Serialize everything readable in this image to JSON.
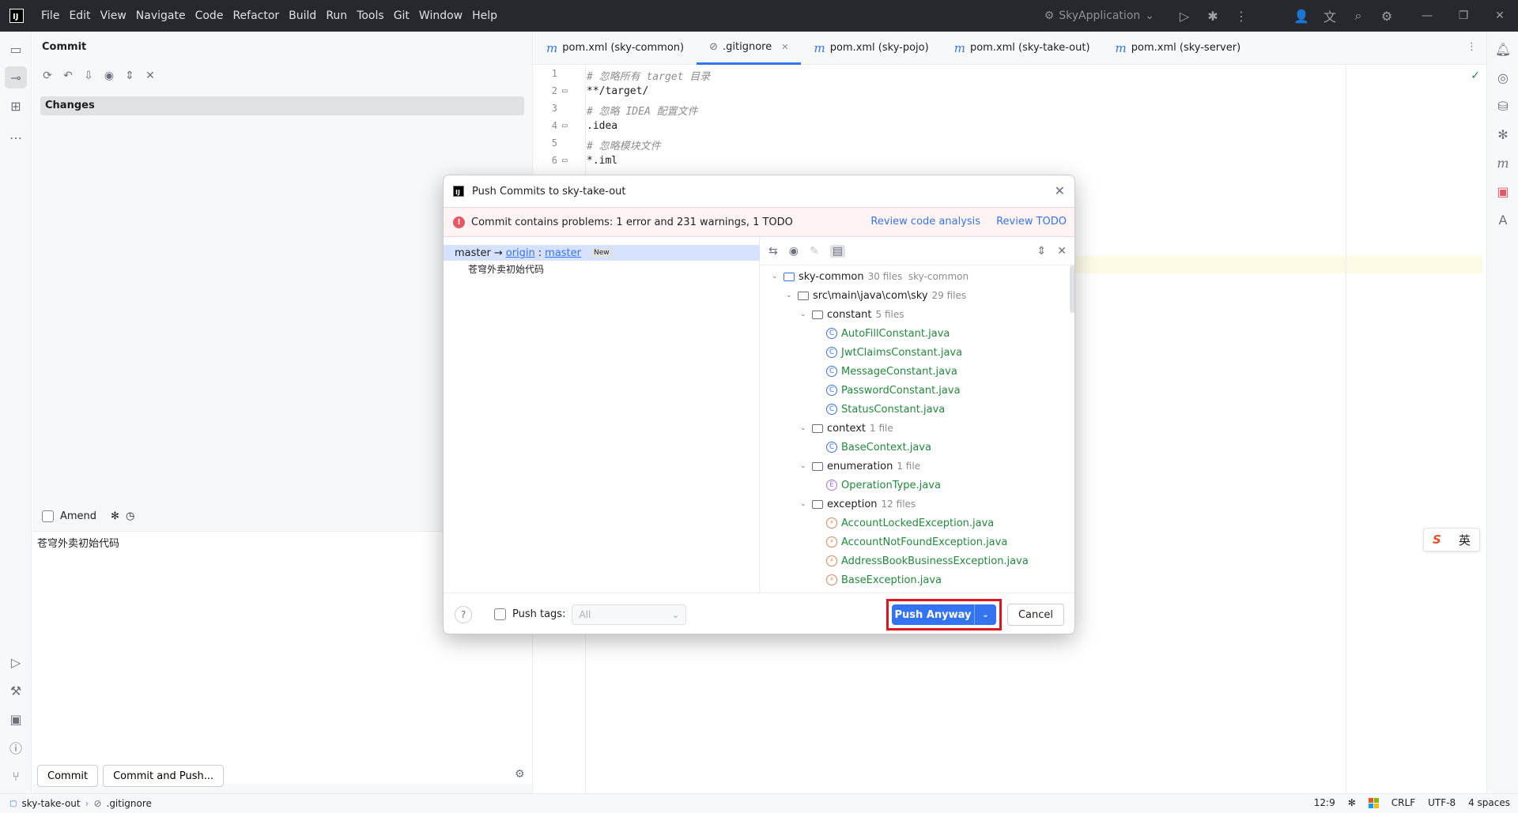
{
  "menu": [
    "File",
    "Edit",
    "View",
    "Navigate",
    "Code",
    "Refactor",
    "Build",
    "Run",
    "Tools",
    "Git",
    "Window",
    "Help"
  ],
  "titlebar": {
    "run_config": "SkyApplication"
  },
  "commit_panel": {
    "title": "Commit",
    "changes_label": "Changes",
    "amend_label": "Amend",
    "message": "苍穹外卖初始代码",
    "commit_button": "Commit",
    "commit_push_button": "Commit and Push..."
  },
  "editor": {
    "tabs": [
      {
        "label": "pom.xml (sky-common)",
        "icon": "m"
      },
      {
        "label": ".gitignore",
        "icon": "ignore"
      },
      {
        "label": "pom.xml (sky-pojo)",
        "icon": "m"
      },
      {
        "label": "pom.xml (sky-take-out)",
        "icon": "m"
      },
      {
        "label": "pom.xml (sky-server)",
        "icon": "m"
      }
    ],
    "lines": [
      {
        "num": "1",
        "text": "# 忽略所有 target 目录",
        "comment": true
      },
      {
        "num": "2",
        "text": "**/target/",
        "comment": false
      },
      {
        "num": "3",
        "text": "# 忽略 IDEA 配置文件",
        "comment": true
      },
      {
        "num": "4",
        "text": ".idea",
        "comment": false
      },
      {
        "num": "5",
        "text": "# 忽略模块文件",
        "comment": true
      },
      {
        "num": "6",
        "text": "*.iml",
        "comment": false
      }
    ]
  },
  "ime": {
    "logo": "S",
    "lang": "英"
  },
  "statusbar": {
    "project": "sky-take-out",
    "file": ".gitignore",
    "position": "12:9",
    "line_sep": "CRLF",
    "encoding": "UTF-8",
    "indent": "4 spaces"
  },
  "dialog": {
    "title": "Push Commits to sky-take-out",
    "banner": "Commit contains problems: 1 error and 231 warnings, 1 TODO",
    "review_analysis": "Review code analysis",
    "review_todo": "Review TODO",
    "branch": {
      "local": "master",
      "arrow": "→",
      "remote": "origin",
      "sep": ":",
      "remote_branch": "master",
      "badge": "New"
    },
    "commit_message": "苍穹外卖初始代码",
    "tree": [
      {
        "name": "sky-common",
        "meta": "30 files  sky-common",
        "level": 0,
        "kind": "module"
      },
      {
        "name": "src\\main\\java\\com\\sky",
        "meta": "29 files",
        "level": 1,
        "kind": "folder"
      },
      {
        "name": "constant",
        "meta": "5 files",
        "level": 2,
        "kind": "folder"
      },
      {
        "name": "AutoFillConstant.java",
        "meta": "",
        "level": 3,
        "kind": "class"
      },
      {
        "name": "JwtClaimsConstant.java",
        "meta": "",
        "level": 3,
        "kind": "class"
      },
      {
        "name": "MessageConstant.java",
        "meta": "",
        "level": 3,
        "kind": "class"
      },
      {
        "name": "PasswordConstant.java",
        "meta": "",
        "level": 3,
        "kind": "class"
      },
      {
        "name": "StatusConstant.java",
        "meta": "",
        "level": 3,
        "kind": "class"
      },
      {
        "name": "context",
        "meta": "1 file",
        "level": 2,
        "kind": "folder"
      },
      {
        "name": "BaseContext.java",
        "meta": "",
        "level": 3,
        "kind": "class"
      },
      {
        "name": "enumeration",
        "meta": "1 file",
        "level": 2,
        "kind": "folder"
      },
      {
        "name": "OperationType.java",
        "meta": "",
        "level": 3,
        "kind": "enum"
      },
      {
        "name": "exception",
        "meta": "12 files",
        "level": 2,
        "kind": "folder"
      },
      {
        "name": "AccountLockedException.java",
        "meta": "",
        "level": 3,
        "kind": "exception"
      },
      {
        "name": "AccountNotFoundException.java",
        "meta": "",
        "level": 3,
        "kind": "exception"
      },
      {
        "name": "AddressBookBusinessException.java",
        "meta": "",
        "level": 3,
        "kind": "exception"
      },
      {
        "name": "BaseException.java",
        "meta": "",
        "level": 3,
        "kind": "exception"
      }
    ],
    "push_tags_label": "Push tags:",
    "push_tags_value": "All",
    "push_button": "Push Anyway",
    "cancel_button": "Cancel",
    "help": "?"
  }
}
